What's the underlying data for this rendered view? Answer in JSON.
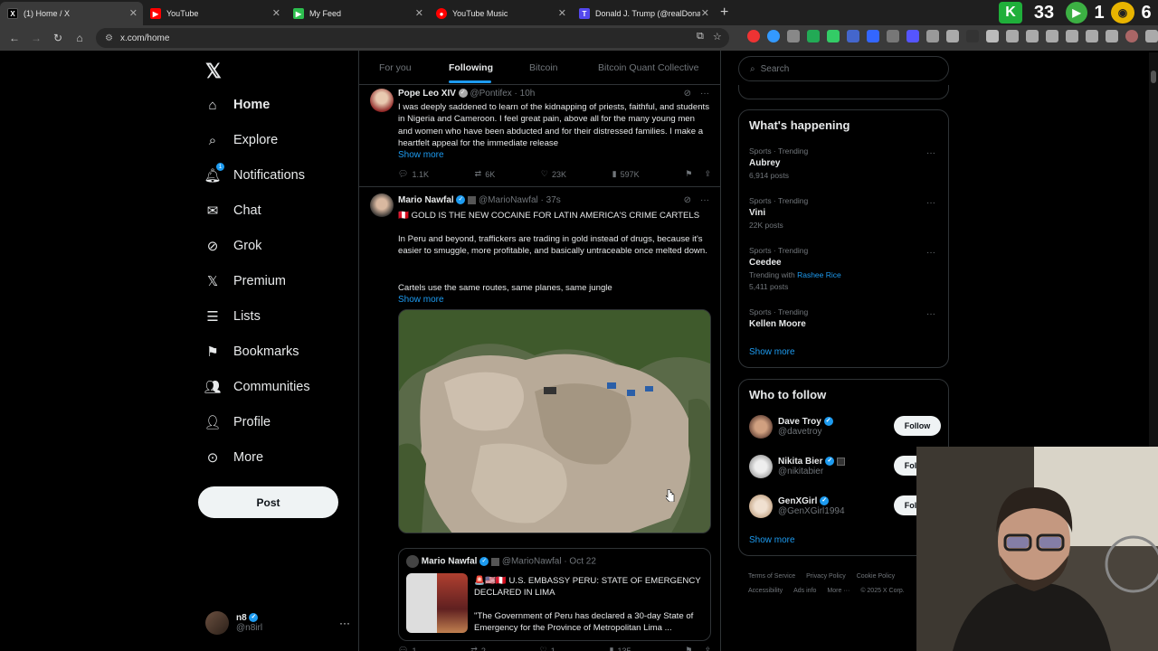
{
  "browser": {
    "tabs": [
      {
        "label": "(1) Home / X",
        "icon": "x-icon",
        "color": "#000000"
      },
      {
        "label": "YouTube",
        "icon": "youtube-icon",
        "color": "#ff0000"
      },
      {
        "label": "My Feed",
        "icon": "feed-icon",
        "color": "#2cbe4e"
      },
      {
        "label": "YouTube Music",
        "icon": "youtube-music-icon",
        "color": "#ff0000"
      },
      {
        "label": "Donald J. Trump (@realDonaldT",
        "icon": "truth-icon",
        "color": "#5448ee"
      }
    ],
    "url": "x.com/home",
    "top_badges": [
      "33",
      "1",
      "6"
    ]
  },
  "nav": {
    "items": [
      {
        "label": "Home",
        "icon": "home-icon"
      },
      {
        "label": "Explore",
        "icon": "search-icon"
      },
      {
        "label": "Notifications",
        "icon": "bell-icon",
        "badge": "1"
      },
      {
        "label": "Chat",
        "icon": "mail-icon"
      },
      {
        "label": "Grok",
        "icon": "grok-icon"
      },
      {
        "label": "Premium",
        "icon": "x-icon"
      },
      {
        "label": "Lists",
        "icon": "list-icon"
      },
      {
        "label": "Bookmarks",
        "icon": "bookmark-icon"
      },
      {
        "label": "Communities",
        "icon": "people-icon"
      },
      {
        "label": "Profile",
        "icon": "person-icon"
      },
      {
        "label": "More",
        "icon": "more-circle-icon"
      }
    ],
    "post_label": "Post",
    "me_name": "n8",
    "me_handle": "@n8irl"
  },
  "feed": {
    "tabs": [
      "For you",
      "Following",
      "Bitcoin",
      "Bitcoin Quant Collective"
    ],
    "active_tab": "Following",
    "tweets": [
      {
        "name": "Pope Leo XIV",
        "handle": "@Pontifex · 10h",
        "text": "I was deeply saddened to learn of the kidnapping of priests, faithful, and students in Nigeria and Cameroon. I feel great pain, above all for the many young men and women who have been abducted and for their distressed families. I make a heartfelt appeal for the immediate release",
        "show_more": "Show more",
        "replies": "1.1K",
        "reposts": "6K",
        "likes": "23K",
        "views": "597K"
      },
      {
        "name": "Mario Nawfal",
        "handle": "@MarioNawfal · 37s",
        "headline": "🇵🇪 GOLD IS THE NEW COCAINE FOR LATIN AMERICA'S CRIME CARTELS",
        "para1": "In Peru and beyond, traffickers are trading in gold instead of drugs, because it's easier to smuggle, more profitable, and basically untraceable once melted down.",
        "para2": "Cartels use the same routes, same planes, same jungle",
        "show_more": "Show more",
        "quote_name": "Mario Nawfal",
        "quote_handle": "@MarioNawfal · Oct 22",
        "quote_title": "🚨🇺🇸🇵🇪 U.S. EMBASSY PERU: STATE OF EMERGENCY DECLARED IN LIMA",
        "quote_text": "\"The Government of Peru has declared a 30-day State of Emergency for the Province of Metropolitan Lima ...",
        "replies": "1",
        "reposts": "2",
        "likes": "1",
        "views": "135"
      }
    ]
  },
  "right": {
    "search_placeholder": "Search",
    "happening_title": "What's happening",
    "trends": [
      {
        "meta": "Sports · Trending",
        "title": "Aubrey",
        "count": "6,914 posts"
      },
      {
        "meta": "Sports · Trending",
        "title": "Vini",
        "count": "22K posts"
      },
      {
        "meta": "Sports · Trending",
        "title": "Ceedee",
        "with_label": "Trending with",
        "with_link": "Rashee Rice",
        "count": "5,411 posts"
      },
      {
        "meta": "Sports · Trending",
        "title": "Kellen Moore"
      }
    ],
    "show_more": "Show more",
    "wtf_title": "Who to follow",
    "follow": [
      {
        "name": "Dave Troy",
        "handle": "@davetroy",
        "btn": "Follow"
      },
      {
        "name": "Nikita Bier",
        "handle": "@nikitabier",
        "btn": "Follow"
      },
      {
        "name": "GenXGirl",
        "handle": "@GenXGirl1994",
        "btn": "Follow"
      }
    ],
    "footer": [
      "Terms of Service",
      "Privacy Policy",
      "Cookie Policy",
      "Accessibility",
      "Ads info",
      "More ···",
      "© 2025 X Corp."
    ]
  },
  "colors": {
    "accent": "#1d9bf0",
    "bg": "#000000",
    "border": "#2f3336",
    "muted": "#71767b"
  }
}
